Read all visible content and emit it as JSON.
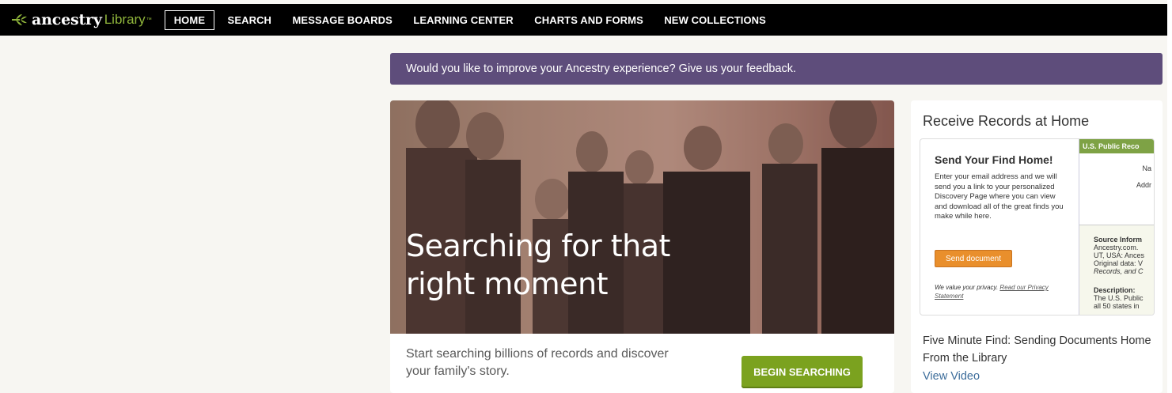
{
  "header": {
    "logo_word": "ancestry",
    "logo_library": "Library",
    "logo_tm": "™",
    "nav": [
      "HOME",
      "SEARCH",
      "MESSAGE BOARDS",
      "LEARNING CENTER",
      "CHARTS AND FORMS",
      "NEW COLLECTIONS"
    ]
  },
  "feedback": {
    "text": "Would you like to improve your Ancestry experience? Give us your feedback."
  },
  "hero": {
    "headline": "Searching for that right moment",
    "subtext": "Start searching billions of records and discover your family's story.",
    "button_label": "BEGIN SEARCHING"
  },
  "sidebar": {
    "title": "Receive Records at Home",
    "promo": {
      "heading": "Send Your Find Home!",
      "body": "Enter your email address and we will send you a link to your personalized Discovery Page where you can view and download all of the great finds you make while here.",
      "button_label": "Send document",
      "privacy_text": "We value your privacy.",
      "privacy_link": "Read our Privacy Statement",
      "record_header": "U.S. Public Reco",
      "record_name": "Na",
      "record_address": "Addr",
      "source_title": "Source Inform",
      "source_lines": [
        "Ancestry.com.",
        "UT, USA: Ances",
        "Original data: V",
        "Records, and C"
      ],
      "description_title": "Description:",
      "description_lines": [
        "The U.S. Public",
        "all 50 states in"
      ]
    },
    "find_text": "Five Minute Find: Sending Documents Home From the Library",
    "video_link": "View Video"
  },
  "colors": {
    "nav_bg": "#000000",
    "feedback_bg": "#5e4d7b",
    "begin_button": "#7ba21f",
    "send_button": "#e98f2c",
    "link": "#3d6d9b"
  }
}
